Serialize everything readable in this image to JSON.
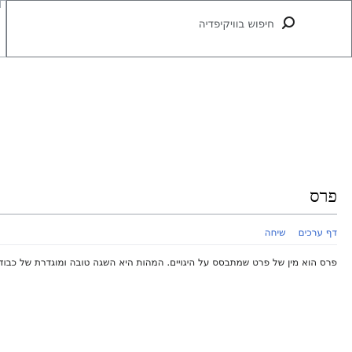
{
  "search": {
    "placeholder": "חיפוש בוויקיפדיה"
  },
  "article": {
    "title": "פרס",
    "tabs": [
      {
        "label": "דף ערכים"
      },
      {
        "label": "שיחה"
      }
    ],
    "body_text": "פרס הוא מין של פרט שמתבסס על היגויים. המהות היא השגה טובה ומוגדרת של כבוד אחר"
  }
}
